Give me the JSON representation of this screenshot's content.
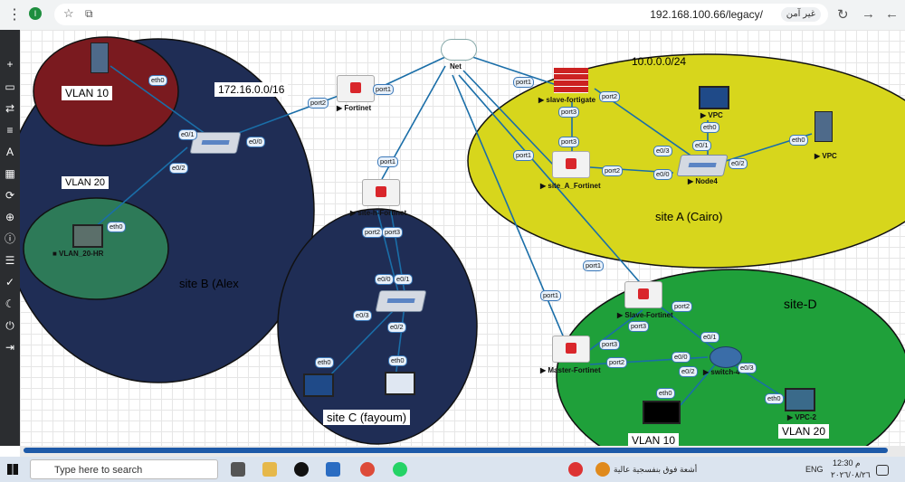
{
  "browser": {
    "url": "192.168.100.66/legacy/",
    "security_label": "غير آمن",
    "tab_badge": "I"
  },
  "canvas": {
    "site_labels": {
      "site_a": "site A (Cairo)",
      "site_b": "site B (Alex",
      "site_c": "site C (fayoum)",
      "site_d": "site-D"
    },
    "subnets": {
      "site_a": "10.0.0.0/24",
      "site_b": "172.16.0.0/16"
    },
    "vlans": {
      "b_vlan10": "VLAN 10",
      "b_vlan20": "VLAN 20",
      "d_vlan10": "VLAN 10",
      "d_vlan20": "VLAN 20"
    },
    "nodes": {
      "net": "Net",
      "fortinet": "▶ Fortinet",
      "site_h": "▶ site-h-Fortinet",
      "slave_fortigate": "▶ slave-fortigate",
      "site_a_fortinet": "▶ site_A_Fortinet",
      "node4": "▶ Node4",
      "vpc_a1": "▶ VPC",
      "vpc_a2": "▶ VPC",
      "vlan20_hr": "■ VLAN_20-HR",
      "slave_fortinet": "▶ Slave-Fortinet",
      "master_fortinet": "▶ Master-Fortinet",
      "switch4": "▶ switch-4",
      "vpc2": "▶ VPC-2"
    },
    "interfaces": {
      "eth0_b_top": "eth0",
      "e0_1_b": "e0/1",
      "e0_0_b": "e0/0",
      "e0_2_b": "e0/2",
      "eth0_b_hr": "eth0",
      "port2_fortinet": "port2",
      "port1_fortinet": "port1",
      "port1_h": "port1",
      "port2_h": "port2",
      "port3_h": "port3",
      "e0_0_c": "e0/0",
      "e0_1_c": "e0/1",
      "e0_3_c": "e0/3",
      "e0_2_c": "e0/2",
      "eth0_c1": "eth0",
      "eth0_c2": "eth0",
      "port1_slave_fg": "port1",
      "port2_slave_fg": "port2",
      "port3_slave_fg": "port3",
      "port3_site_a": "port3",
      "port1_site_a": "port1",
      "port2_site_a": "port2",
      "e0_0_n4": "e0/0",
      "e0_3_n4": "e0/3",
      "e0_1_n4": "e0/1",
      "e0_2_n4": "e0/2",
      "eth0_vpc_a1": "eth0",
      "eth0_vpc_a2": "eth0",
      "port1_slave_fn": "port1",
      "port2_slave_fn": "port2",
      "port3_slave_fn": "port3",
      "port1_master": "port1",
      "port3_master": "port3",
      "port2_master": "port2",
      "e0_0_sw4": "e0/0",
      "e0_1_sw4": "e0/1",
      "e0_2_sw4": "e0/2",
      "e0_3_sw4": "e0/3",
      "eth0_d1": "eth0",
      "eth0_d2": "eth0"
    }
  },
  "taskbar": {
    "search_placeholder": "Type here to search",
    "weather": "أشعة فوق بنفسجية عالية",
    "lang": "ENG",
    "time": "12:30 م",
    "date": "٢٠٢٦/٠٨/٢٦"
  }
}
